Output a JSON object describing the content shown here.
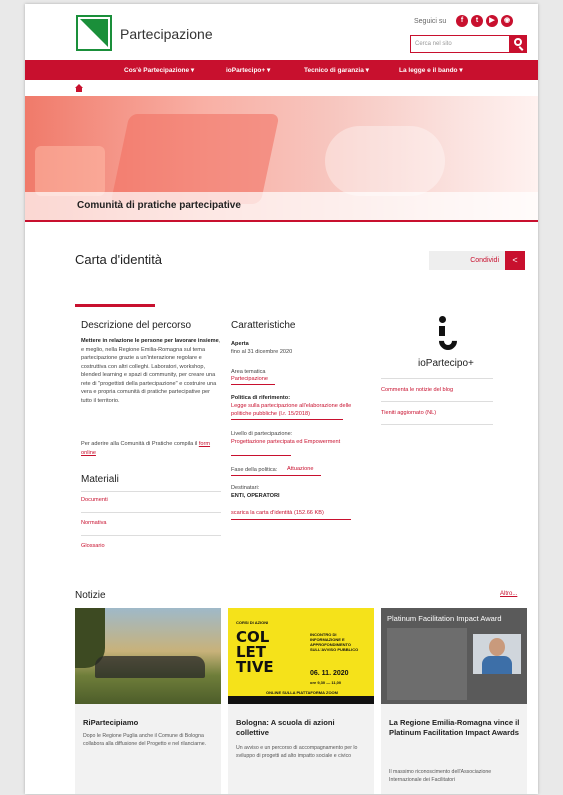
{
  "header": {
    "site_title": "Partecipazione",
    "follow_label": "Seguici su",
    "social": [
      {
        "name": "facebook",
        "glyph": "f"
      },
      {
        "name": "twitter",
        "glyph": "t"
      },
      {
        "name": "youtube",
        "glyph": "▶"
      },
      {
        "name": "rss",
        "glyph": "◉"
      }
    ],
    "search_placeholder": "Cerca nel sito"
  },
  "nav": {
    "items": [
      "Cos'è Partecipazione ▾",
      "ioPartecipo+ ▾",
      "Tecnico di garanzia ▾",
      "La legge e il bando ▾"
    ]
  },
  "hero": {
    "title": "Comunità di pratiche partecipative"
  },
  "page": {
    "title": "Carta d'identità",
    "share_label": "Condividi"
  },
  "descrizione": {
    "heading": "Descrizione del percorso",
    "text_bold": "Mettere in relazione le persone per lavorare insieme",
    "text_rest": ", e meglio, nella Regione Emilia-Romagna sul tema partecipazione grazie a un'interazione regolare e costruttiva con altri colleghi. Laboratori, workshop, blended learning e spazi di community, per creare una rete di \"progettisti della partecipazione\" e costruire una vera e propria comunità di pratiche partecipative per tutto il territorio.",
    "join_text": "Per aderire alla Comunità di Pratiche compila il ",
    "join_link": "form online"
  },
  "materiali": {
    "heading": "Materiali",
    "items": [
      "Documenti",
      "Normativa",
      "Glossario"
    ]
  },
  "caratteristiche": {
    "heading": "Caratteristiche",
    "status": "Aperta",
    "status_detail": "fino al 31 dicembre 2020",
    "area_label": "Area tematica",
    "area_value": "Partecipazione",
    "politica_label": "Politica di riferimento:",
    "politica_value": "Legge sulla partecipazione all'elaborazione delle politiche pubbliche (l.r. 15/2018)",
    "livello_label": "Livello di partecipazione:",
    "livello_value": "Progettazione partecipata ed Empowerment",
    "fase_label": "Fase della politica:",
    "fase_value": "Attuazione",
    "destinatari_label": "Destinatari:",
    "destinatari_value": "ENTI, OPERATORI",
    "download": "scarica la carta d'identità (",
    "download_size": "152.66 KB)"
  },
  "aside": {
    "logo_text": "ioPartecipo+",
    "links": [
      "Commenta le notizie del blog",
      "Tieniti aggiornato (NL)"
    ]
  },
  "notizie": {
    "heading": "Notizie",
    "more": "Altro...",
    "cards": [
      {
        "title": "RiPartecipiamo",
        "desc": "Dopo le Regione Puglia anche il Comune di Bologna collabora alla diffusione del Progetto e nel rilanciarne."
      },
      {
        "title": "Bologna: A scuola di azioni collettive",
        "desc": "Un avviso e un percorso di accompagnamento per lo sviluppo di progetti ad alto impatto sociale e civico",
        "img": {
          "l1": "COL",
          "l2": "LET",
          "l3": "TIVE",
          "date": "06. 11. 2020",
          "time": "ore 9,30 — 11,00",
          "small_top": "CORSI DI AZIONI",
          "info": "INCONTRO DI INFORMAZIONE E APPROFONDIMENTO SULL'AVVISO PUBBLICO",
          "bottom": "ONLINE SULLA PIATTAFORMA ZOOM"
        }
      },
      {
        "title": "La Regione Emilia-Romagna vince il Platinum Facilitation Impact Awards",
        "desc": "Il massimo riconoscimento dell'Associazione Internazionale dei Facilitatori",
        "img": {
          "title": "Platinum Facilitation Impact Award"
        }
      }
    ]
  }
}
